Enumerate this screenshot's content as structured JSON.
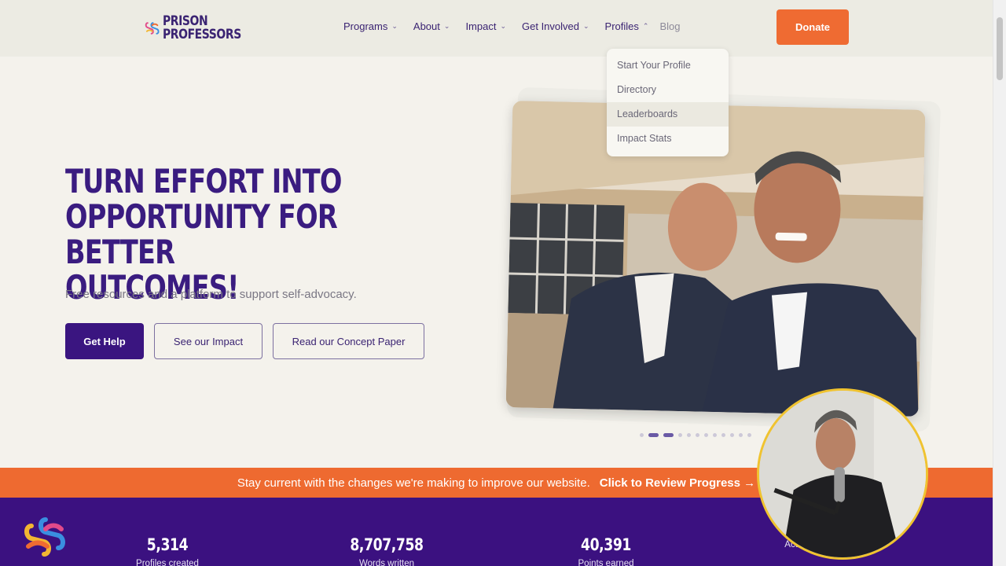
{
  "header": {
    "logo_text_line1": "PRISON",
    "logo_text_line2": "PROFESSORS",
    "nav": [
      {
        "label": "Programs"
      },
      {
        "label": "About"
      },
      {
        "label": "Impact"
      },
      {
        "label": "Get Involved"
      },
      {
        "label": "Profiles"
      },
      {
        "label": "Blog"
      }
    ],
    "donate_label": "Donate"
  },
  "profiles_dropdown": {
    "items": [
      {
        "label": "Start Your Profile"
      },
      {
        "label": "Directory"
      },
      {
        "label": "Leaderboards"
      },
      {
        "label": "Impact Stats"
      }
    ]
  },
  "hero": {
    "title_line1": "TURN EFFORT INTO",
    "title_line2": "OPPORTUNITY FOR BETTER",
    "title_line3": "OUTCOMES!",
    "subtitle": "Free resources and a platform to support self-advocacy.",
    "buttons": {
      "get_help": "Get Help",
      "see_impact": "See our Impact",
      "concept_paper": "Read our Concept Paper"
    },
    "carousel_active_index": 1,
    "carousel_count": 12
  },
  "banner": {
    "text": "Stay current with the changes we're making to improve our website.",
    "link": "Click to Review Progress →"
  },
  "stats": [
    {
      "value": "5,314",
      "label": "Profiles created"
    },
    {
      "value": "8,707,758",
      "label": "Words written"
    },
    {
      "value": "40,391",
      "label": "Points earned"
    },
    {
      "value": "",
      "label": "Active facilities"
    }
  ],
  "colors": {
    "brand_purple": "#3a1c80",
    "accent_orange": "#ef6b32",
    "background": "#f4f2ec",
    "webcam_ring": "#f0c330"
  }
}
